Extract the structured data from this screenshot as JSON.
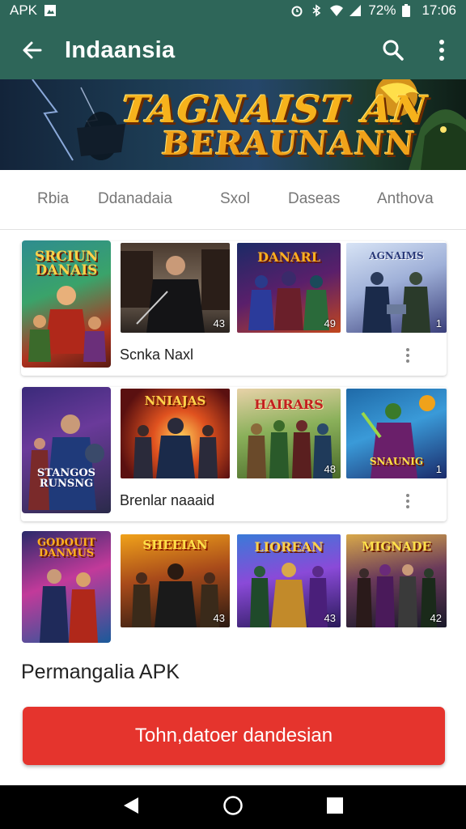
{
  "statusbar": {
    "left_text": "APK",
    "battery": "72%",
    "time": "17:06"
  },
  "appbar": {
    "title": "Indaansia"
  },
  "banner": {
    "line1": "TAGNAIST AN",
    "line2": "BERAUNANN"
  },
  "tabs": [
    "Rbia",
    "Ddanadaia",
    "Sxol",
    "Daseas",
    "Anthova"
  ],
  "rows": [
    {
      "label": "Scnka Naxl",
      "cover_title": "SRCIUN DANAIS",
      "thumbs": [
        {
          "title": "",
          "badge": "43"
        },
        {
          "title": "DANARL",
          "badge": "49"
        },
        {
          "title": "AGNAIMS",
          "badge": "1"
        }
      ]
    },
    {
      "label": "Brenlar naaaid",
      "cover_title": "STANGOS RUNSNG",
      "thumbs": [
        {
          "title": "NNIAJAS",
          "badge": ""
        },
        {
          "title": "HAIRARS",
          "badge": "48"
        },
        {
          "title": "SNAUNIG",
          "badge": "1"
        }
      ]
    },
    {
      "label": "",
      "cover_title": "GODOUIT DANMUS",
      "thumbs": [
        {
          "title": "SHEEIAN",
          "badge": "43"
        },
        {
          "title": "LIOREAN",
          "badge": "43"
        },
        {
          "title": "MIGNADE",
          "badge": "42"
        }
      ]
    }
  ],
  "section_title": "Permangalia APK",
  "cta_label": "Tohn,datoer dandesian",
  "colors": {
    "appbar": "#2e6659",
    "cta": "#e5342d"
  }
}
